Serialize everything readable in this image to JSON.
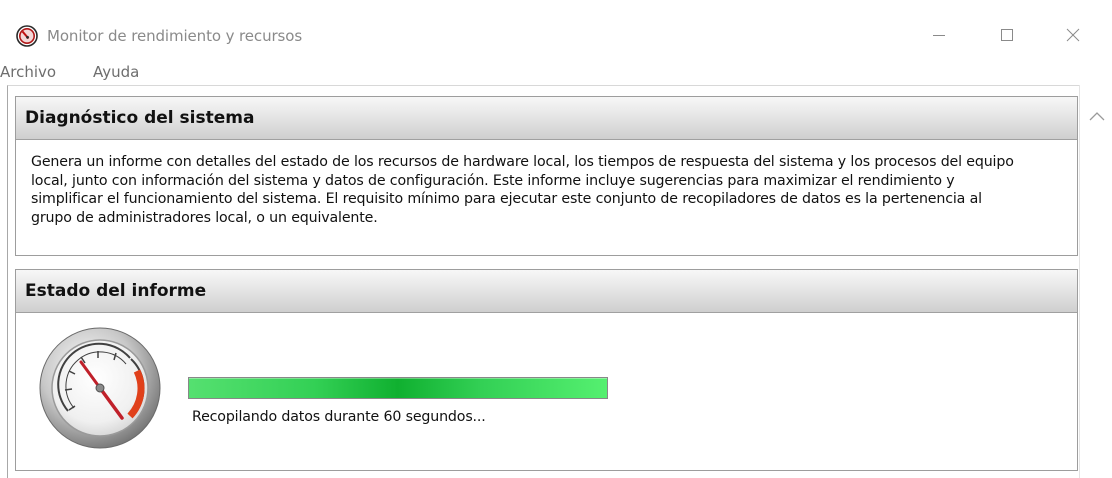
{
  "window": {
    "title": "Monitor de rendimiento y recursos",
    "minimize_glyph": "—",
    "maximize_glyph": "☐",
    "close_glyph": "✕"
  },
  "menu": {
    "items": [
      {
        "label": "Archivo"
      },
      {
        "label": "Ayuda"
      }
    ]
  },
  "diagnostic_panel": {
    "title": "Diagnóstico del sistema",
    "lines": [
      "Genera un informe con detalles del estado de los recursos de hardware local, los tiempos de respuesta del sistema y los procesos del equipo",
      "local, junto con información del sistema y datos de configuración. Este informe incluye sugerencias para maximizar el rendimiento y",
      "simplificar el funcionamiento del sistema. El requisito mínimo para ejecutar este conjunto de recopiladores de datos es la pertenencia al",
      "grupo de administradores local, o un equivalente."
    ]
  },
  "report_panel": {
    "title": "Estado del informe",
    "progress_percent": 100,
    "status": "Recopilando datos durante 60 segundos..."
  },
  "colors": {
    "progress_green": "#22c040",
    "gauge_needle": "#c0202a",
    "gauge_red_zone": "#e0401a"
  },
  "icons": {
    "app": "performance-monitor-icon",
    "gauge": "speedometer-gauge-icon"
  }
}
